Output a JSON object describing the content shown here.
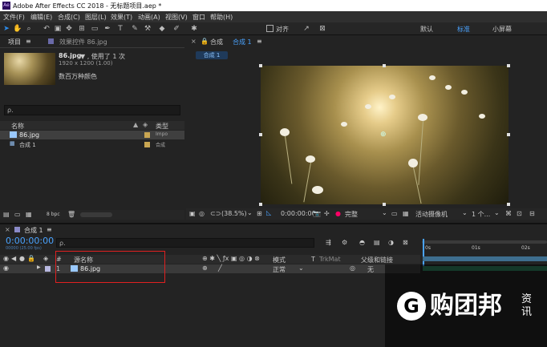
{
  "window": {
    "title": "Adobe After Effects CC 2018 - 无标题项目.aep *",
    "app_icon": "Ae"
  },
  "menu": [
    "文件(F)",
    "编辑(E)",
    "合成(C)",
    "图层(L)",
    "效果(T)",
    "动画(A)",
    "视图(V)",
    "窗口",
    "帮助(H)"
  ],
  "toolbar": {
    "snap_label": "对齐",
    "workspaces": [
      "默认",
      "标准",
      "小屏幕"
    ],
    "active_workspace": "标准"
  },
  "project_panel": {
    "tab_label": "项目",
    "effects_tab_label": "效果控件 86.jpg",
    "file_name": "86.jpg",
    "usage": "▼ , 使用了 1 次",
    "dimensions": "1920 x 1200 (1.00)",
    "color_info": "数百万种颜色",
    "search_placeholder": "ρ.",
    "col_name": "名称",
    "col_type": "类型",
    "items": [
      {
        "name": "86.jpg",
        "type": "Impo",
        "selected": true
      },
      {
        "name": "合成 1",
        "type": "合成",
        "selected": false
      }
    ],
    "bpc": "8 bpc"
  },
  "comp_panel": {
    "tab_prefix": "合成",
    "tab_comp": "合成 1",
    "breadcrumb": "合成 1",
    "zoom": "(38.5%)",
    "timecode": "0:00:00:00",
    "quality": "完整",
    "camera": "活动摄像机",
    "views": "1 个..."
  },
  "timeline": {
    "tab_label": "合成 1",
    "timecode": "0:00:00:00",
    "frame_info": "00000 (25.00 fps)",
    "search_placeholder": "ρ.",
    "col_num": "#",
    "col_source": "源名称",
    "col_mode": "模式",
    "col_t": "T",
    "col_trkmat": "TrkMat",
    "col_parent": "父级和链接",
    "ruler": [
      "0s",
      "01s",
      "02s"
    ],
    "layer": {
      "index": "1",
      "name": "86.jpg",
      "mode": "正常",
      "parent": "无"
    }
  },
  "watermark": {
    "logo": "G",
    "text": "购团邦",
    "side": "资讯"
  },
  "colors": {
    "accent": "#2d8ceb",
    "highlight": "#e02020",
    "track": "#2e7d5c"
  }
}
